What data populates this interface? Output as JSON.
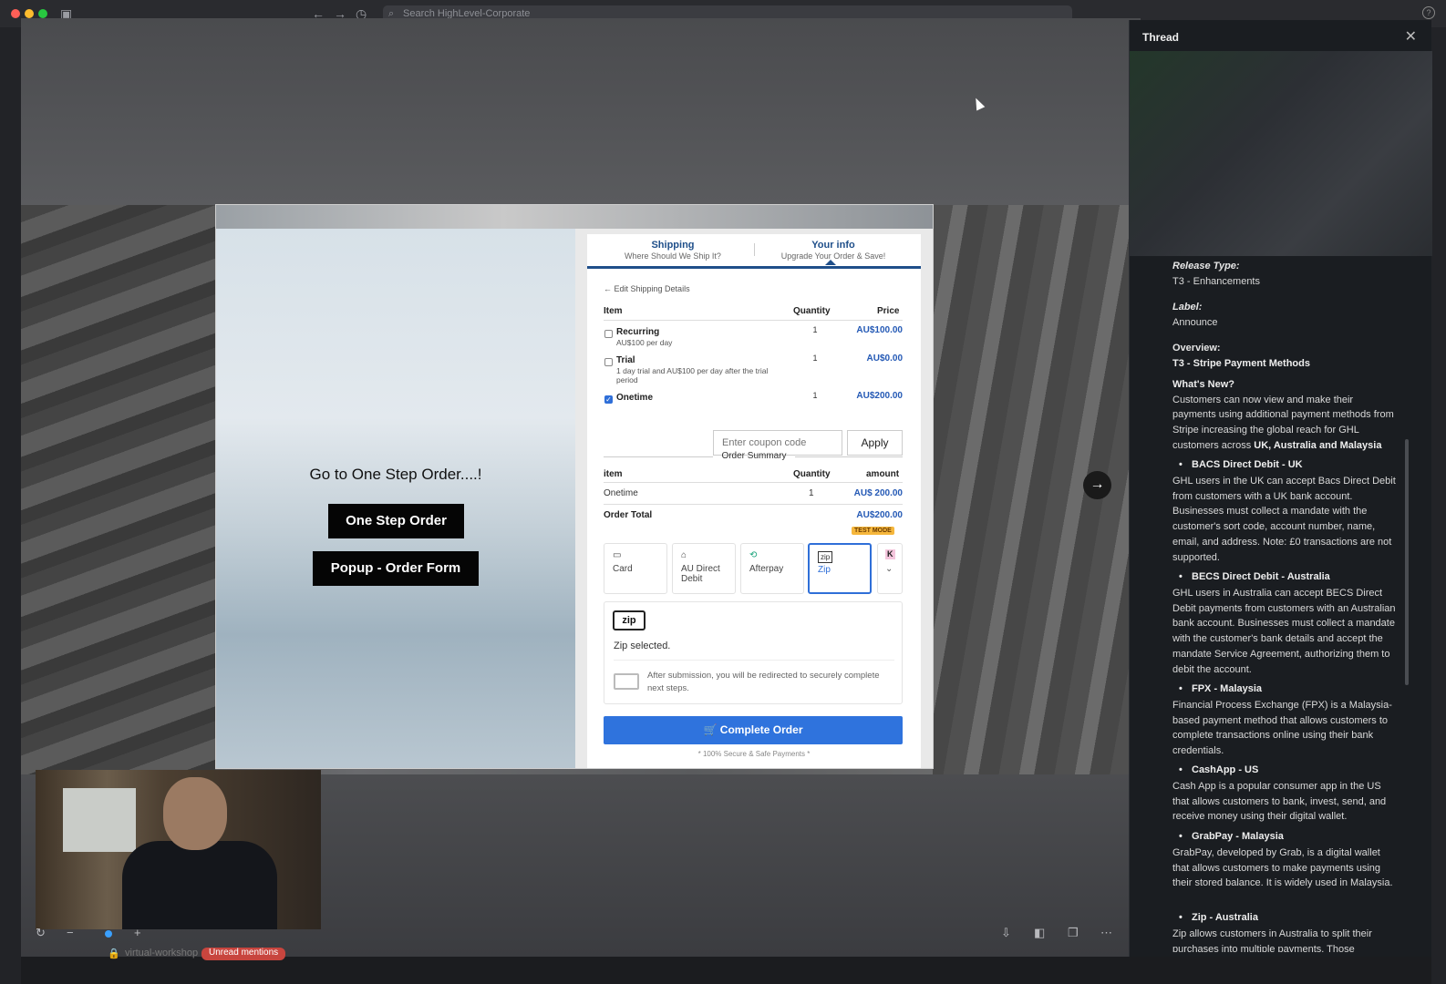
{
  "titlebar": {
    "search_placeholder": "Search HighLevel-Corporate"
  },
  "modal": {
    "goto_text": "Go to One Step Order....!",
    "btn_one_step": "One Step Order",
    "btn_popup": "Popup - Order Form"
  },
  "form": {
    "tabs": [
      {
        "title": "Shipping",
        "subtitle": "Where Should We Ship It?"
      },
      {
        "title": "Your info",
        "subtitle": "Upgrade Your Order & Save!"
      }
    ],
    "edit_shipping": "Edit Shipping Details",
    "headers": {
      "item": "Item",
      "quantity": "Quantity",
      "price": "Price"
    },
    "items": [
      {
        "name": "Recurring",
        "sub": "AU$100 per day",
        "qty": "1",
        "price": "AU$100.00",
        "checked": false
      },
      {
        "name": "Trial",
        "sub": "1 day trial and AU$100 per day after the trial period",
        "qty": "1",
        "price": "AU$0.00",
        "checked": false
      },
      {
        "name": "Onetime",
        "sub": "",
        "qty": "1",
        "price": "AU$200.00",
        "checked": true
      }
    ],
    "coupon_placeholder": "Enter coupon code",
    "apply_label": "Apply",
    "order_summary": {
      "title": "Order Summary",
      "headers": {
        "item": "item",
        "quantity": "Quantity",
        "amount": "amount"
      },
      "row": {
        "item": "Onetime",
        "qty": "1",
        "amount": "AU$ 200.00"
      },
      "total_label": "Order Total",
      "total_value": "AU$200.00",
      "test_mode": "TEST MODE"
    },
    "payment_methods": [
      {
        "label": "Card",
        "icon": "card-icon"
      },
      {
        "label": "AU Direct Debit",
        "icon": "bank-icon"
      },
      {
        "label": "Afterpay",
        "icon": "afterpay-icon"
      },
      {
        "label": "Zip",
        "icon": "zip-icon",
        "selected": true
      },
      {
        "label": "",
        "icon": "klarna-icon"
      }
    ],
    "zip": {
      "logo": "zip",
      "selected_text": "Zip selected.",
      "redirect_text": "After submission, you will be redirected to securely complete next steps."
    },
    "complete_label": "Complete Order",
    "secure_text": "* 100% Secure & Safe Payments *"
  },
  "bottom": {
    "channel": "virtual-workshop",
    "unread": "Unread mentions"
  },
  "thread": {
    "title": "Thread",
    "release_type_label": "Release Type:",
    "release_type": "T3 - Enhancements",
    "label_label": "Label:",
    "label": "Announce",
    "overview_label": "Overview:",
    "overview": "T3 - Stripe Payment Methods",
    "whats_new_label": "What's New?",
    "whats_new_text": "Customers can now view and make their payments using additional payment methods from Stripe increasing the global reach for GHL customers across",
    "whats_new_bold": "UK, Australia and Malaysia",
    "bullets": [
      {
        "title": "BACS Direct Debit - UK",
        "text": "GHL users in the UK can accept Bacs Direct Debit from customers with a UK bank account. Businesses must collect a mandate with the customer's sort code, account number, name, email, and address. Note: £0 transactions are not supported."
      },
      {
        "title": "BECS Direct Debit - Australia",
        "text": "GHL users in Australia can accept BECS Direct Debit payments from customers with an Australian bank account. Businesses must collect a mandate with the customer's bank details and accept the mandate Service Agreement, authorizing them to debit the account."
      },
      {
        "title": "FPX - Malaysia",
        "text": "Financial Process Exchange (FPX) is a Malaysia-based payment method that allows customers to complete transactions online using their bank credentials."
      },
      {
        "title": "CashApp - US",
        "text": "Cash App is a popular consumer app in the US that allows customers to bank, invest, send, and receive money using their digital wallet."
      },
      {
        "title": "GrabPay - Malaysia",
        "text": "GrabPay, developed by Grab, is a digital wallet that allows customers to make payments using their stored balance. It is widely used in Malaysia."
      },
      {
        "title": "Zip - Australia",
        "text": "Zip allows customers in Australia to split their purchases into multiple payments. Those"
      }
    ]
  }
}
